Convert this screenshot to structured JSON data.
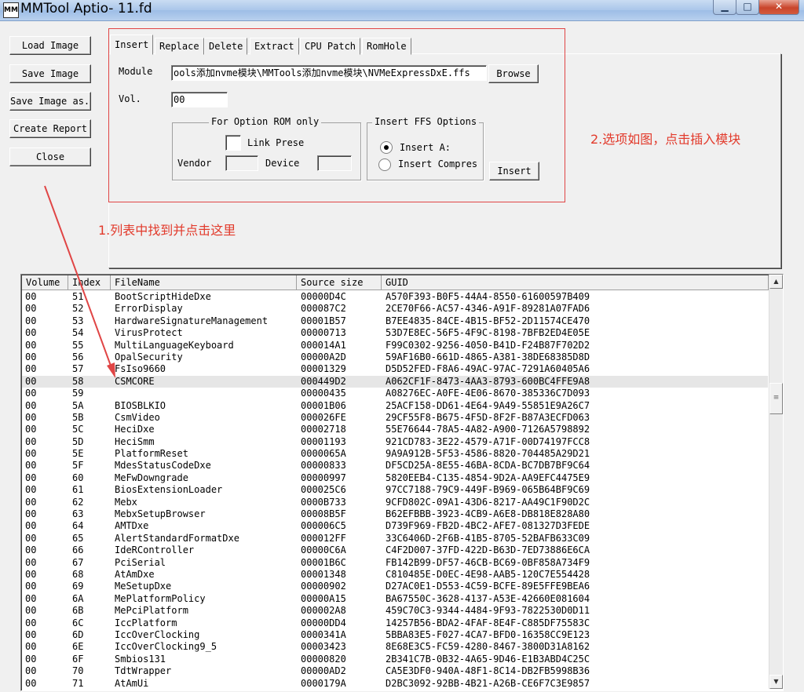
{
  "window": {
    "title": "MMTool Aptio- 11.fd",
    "icon_text": "MM",
    "min_glyph": "▁",
    "max_glyph": "□",
    "close_glyph": "✕"
  },
  "sidebar": {
    "load": "Load Image",
    "save": "Save Image",
    "save_as": "Save Image as..",
    "report": "Create Report",
    "close": "Close"
  },
  "tabs": [
    "Insert",
    "Replace",
    "Delete",
    "Extract",
    "CPU Patch",
    "RomHole"
  ],
  "insert": {
    "module_label": "Module",
    "module_value": "ools添加nvme模块\\MMTools添加nvme模块\\NVMeExpressDxE.ffs",
    "browse": "Browse",
    "vol_label": "Vol.",
    "vol_value": "00",
    "option_rom_title": "For Option ROM only",
    "link_present": "Link Prese",
    "vendor": "Vendor",
    "device": "Device",
    "ffs_title": "Insert FFS Options",
    "insert_as": "Insert A:",
    "insert_compressed": "Insert Compres",
    "insert_button": "Insert"
  },
  "annotations": {
    "step1": "1.列表中找到并点击这里",
    "step2": "2.选项如图，点击插入模块"
  },
  "columns": [
    "Volume",
    "Index",
    "FileName",
    "Source size",
    "GUID"
  ],
  "rows": [
    [
      "00",
      "51",
      "BootScriptHideDxe",
      "00000D4C",
      "A570F393-B0F5-44A4-8550-61600597B409"
    ],
    [
      "00",
      "52",
      "ErrorDisplay",
      "000087C2",
      "2CE70F66-AC57-4346-A91F-89281A07FAD6"
    ],
    [
      "00",
      "53",
      "HardwareSignatureManagement",
      "00001B57",
      "B7EE4835-84CE-4B15-BF52-2D11574CE470"
    ],
    [
      "00",
      "54",
      "VirusProtect",
      "00000713",
      "53D7E8EC-56F5-4F9C-8198-7BFB2ED4E05E"
    ],
    [
      "00",
      "55",
      "MultiLanguageKeyboard",
      "000014A1",
      "F99C0302-9256-4050-B41D-F24B87F702D2"
    ],
    [
      "00",
      "56",
      "OpalSecurity",
      "00000A2D",
      "59AF16B0-661D-4865-A381-38DE68385D8D"
    ],
    [
      "00",
      "57",
      "FsIso9660",
      "00001329",
      "D5D52FED-F8A6-49AC-97AC-7291A60405A6"
    ],
    [
      "00",
      "58",
      "CSMCORE",
      "000449D2",
      "A062CF1F-8473-4AA3-8793-600BC4FFE9A8"
    ],
    [
      "00",
      "59",
      "",
      "00000435",
      "A08276EC-A0FE-4E06-8670-385336C7D093"
    ],
    [
      "00",
      "5A",
      "BIOSBLKIO",
      "00001B06",
      "25ACF158-DD61-4E64-9A49-55851E9A26C7"
    ],
    [
      "00",
      "5B",
      "CsmVideo",
      "000026FE",
      "29CF55F8-B675-4F5D-8F2F-B87A3ECFD063"
    ],
    [
      "00",
      "5C",
      "HeciDxe",
      "00002718",
      "55E76644-78A5-4A82-A900-7126A5798892"
    ],
    [
      "00",
      "5D",
      "HeciSmm",
      "00001193",
      "921CD783-3E22-4579-A71F-00D74197FCC8"
    ],
    [
      "00",
      "5E",
      "PlatformReset",
      "0000065A",
      "9A9A912B-5F53-4586-8820-704485A29D21"
    ],
    [
      "00",
      "5F",
      "MdesStatusCodeDxe",
      "00000833",
      "DF5CD25A-8E55-46BA-8CDA-BC7DB7BF9C64"
    ],
    [
      "00",
      "60",
      "MeFwDowngrade",
      "00000997",
      "5820EEB4-C135-4854-9D2A-AA9EFC4475E9"
    ],
    [
      "00",
      "61",
      "BiosExtensionLoader",
      "000025C6",
      "97CC7188-79C9-449F-B969-065B64BF9C69"
    ],
    [
      "00",
      "62",
      "Mebx",
      "0000B733",
      "9CFD802C-09A1-43D6-8217-AA49C1F90D2C"
    ],
    [
      "00",
      "63",
      "MebxSetupBrowser",
      "00008B5F",
      "B62EFBBB-3923-4CB9-A6E8-DB818E828A80"
    ],
    [
      "00",
      "64",
      "AMTDxe",
      "000006C5",
      "D739F969-FB2D-4BC2-AFE7-081327D3FEDE"
    ],
    [
      "00",
      "65",
      "AlertStandardFormatDxe",
      "000012FF",
      "33C6406D-2F6B-41B5-8705-52BAFB633C09"
    ],
    [
      "00",
      "66",
      "IdeRController",
      "00000C6A",
      "C4F2D007-37FD-422D-B63D-7ED73886E6CA"
    ],
    [
      "00",
      "67",
      "PciSerial",
      "00001B6C",
      "FB142B99-DF57-46CB-BC69-0BF858A734F9"
    ],
    [
      "00",
      "68",
      "AtAmDxe",
      "00001348",
      "C810485E-D0EC-4E98-AAB5-120C7E554428"
    ],
    [
      "00",
      "69",
      "MeSetupDxe",
      "00000902",
      "D27AC0E1-D553-4C59-BCFE-89E5FFE9BEA6"
    ],
    [
      "00",
      "6A",
      "MePlatformPolicy",
      "00000A15",
      "BA67550C-3628-4137-A53E-42660E081604"
    ],
    [
      "00",
      "6B",
      "MePciPlatform",
      "000002A8",
      "459C70C3-9344-4484-9F93-7822530D0D11"
    ],
    [
      "00",
      "6C",
      "IccPlatform",
      "00000DD4",
      "14257B56-BDA2-4FAF-8E4F-C885DF75583C"
    ],
    [
      "00",
      "6D",
      "IccOverClocking",
      "0000341A",
      "5BBA83E5-F027-4CA7-BFD0-16358CC9E123"
    ],
    [
      "00",
      "6E",
      "IccOverClocking9_5",
      "00003423",
      "8E68E3C5-FC59-4280-8467-3800D31A8162"
    ],
    [
      "00",
      "6F",
      "Smbios131",
      "00000820",
      "2B341C7B-0B32-4A65-9D46-E1B3ABD4C25C"
    ],
    [
      "00",
      "70",
      "TdtWrapper",
      "00000AD2",
      "CA5E3DF0-940A-48F1-8C14-DB2FB5998B36"
    ],
    [
      "00",
      "71",
      "AtAmUi",
      "0000179A",
      "D2BC3092-92BB-4B21-A26B-CE6F7C3E9857"
    ]
  ],
  "selected_row_index": 7,
  "colors": {
    "annotation_red": "#e23a2b",
    "selected_row": "#e6e6e6"
  }
}
